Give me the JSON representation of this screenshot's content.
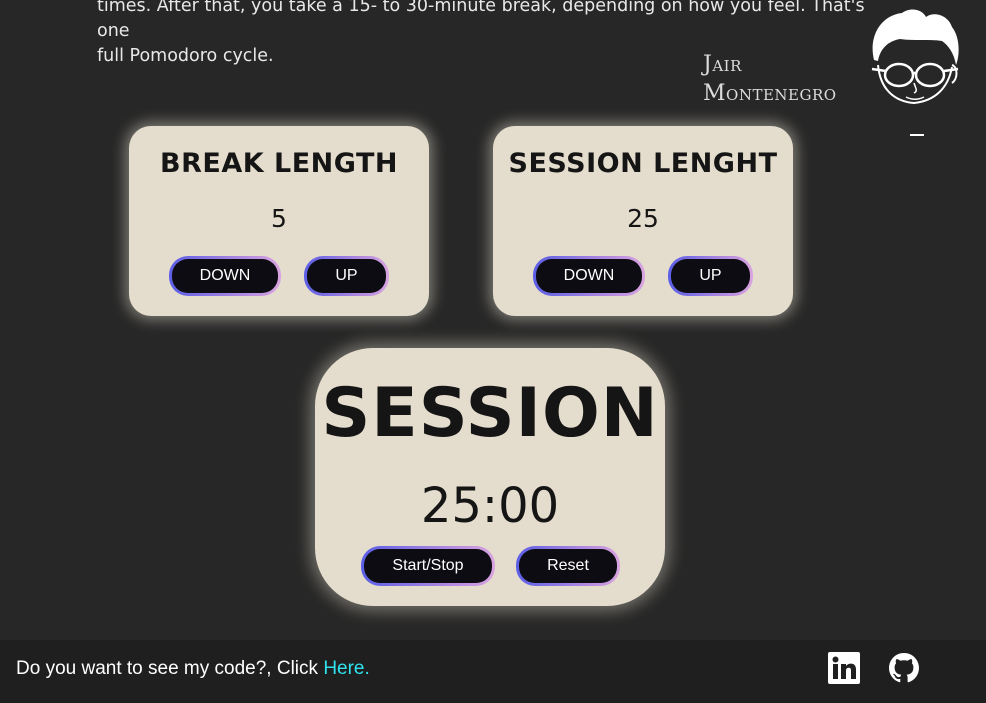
{
  "intro": {
    "line1": "times. After that, you take a 15- to 30-minute break, depending on how you feel. That's one",
    "line2": "full Pomodoro cycle."
  },
  "brand": {
    "first": "Jair",
    "last": "Montenegro"
  },
  "break_card": {
    "title": "BREAK LENGTH",
    "value": "5",
    "down_label": "DOWN",
    "up_label": "UP"
  },
  "session_card": {
    "title": "SESSION LENGHT",
    "value": "25",
    "down_label": "DOWN",
    "up_label": "UP"
  },
  "timer": {
    "label": "SESSION",
    "time": "25:00",
    "start_stop_label": "Start/Stop",
    "reset_label": "Reset"
  },
  "footer": {
    "text": "Do you want to see my code?, Click ",
    "link_text": "Here.",
    "icons": [
      "linkedin-icon",
      "github-icon"
    ]
  },
  "colors": {
    "background": "#272727",
    "card": "#e4dccc",
    "button": "#0c0c12",
    "link": "#2fe2ee"
  }
}
